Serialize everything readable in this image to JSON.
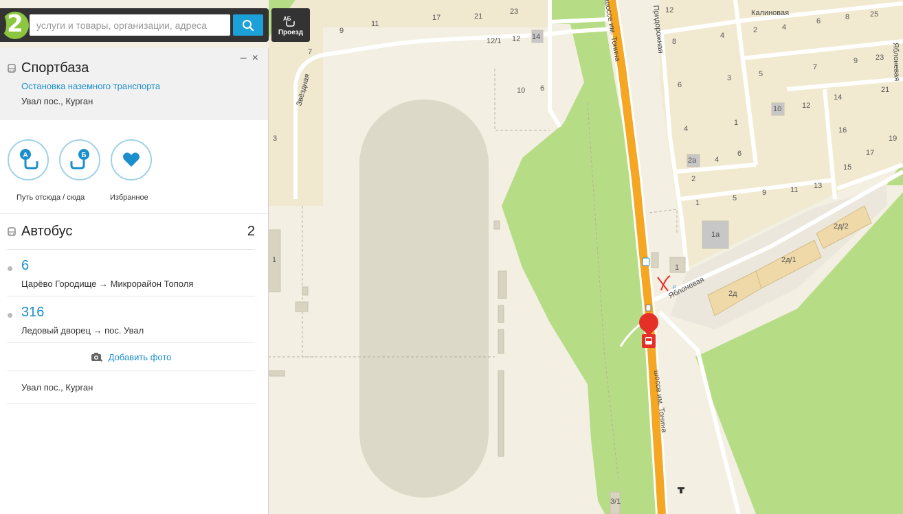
{
  "search": {
    "logo_text": "2",
    "placeholder": "услуги и товары, организации, адреса",
    "route_button_label": "Проезд",
    "route_icon_text": "АБ"
  },
  "panel": {
    "title": "Спортбаза",
    "type_link": "Остановка наземного транспорта",
    "address": "Увал пос., Курган",
    "minimize_symbol": "–",
    "close_symbol": "×",
    "actions": {
      "route_label": "Путь отсюда / сюда",
      "route_a": "А",
      "route_b": "Б",
      "favorites_label": "Избранное"
    },
    "transport": {
      "label": "Автобус",
      "count": "2",
      "routes": [
        {
          "number": "6",
          "direction": "Царёво Городище → Микрорайон Тополя"
        },
        {
          "number": "316",
          "direction": "Ледовый дворец → пос. Увал"
        }
      ]
    },
    "add_photo_label": "Добавить фото",
    "footer_address": "Увал пос., Курган"
  },
  "map": {
    "streets": {
      "zvezdnaya": "Звёздная",
      "kalinovaya": "Калиновая",
      "pridorozhnaya": "Придорожная",
      "yablonevaya": "Яблоневая",
      "shosse_upper": "шоссе им. Тонина",
      "shosse_lower": "шоссе им. Тонина"
    },
    "house_numbers": {
      "h9": "9",
      "h11": "11",
      "h17": "17",
      "h21": "21",
      "h23": "23",
      "h12_1": "12/1",
      "h12": "12",
      "h14": "14",
      "h10": "10",
      "h6": "6",
      "h7": "7",
      "h3": "3",
      "h1_left": "1",
      "r12": "12",
      "r8": "8",
      "r4": "4",
      "r2": "2",
      "r4b": "4",
      "r6": "6",
      "r8b": "8",
      "r25": "25",
      "r23": "23",
      "r9": "9",
      "r7": "7",
      "r5": "5",
      "r3": "3",
      "r6b": "6",
      "r21": "21",
      "r14": "14",
      "r10": "10",
      "r12b": "12",
      "r1": "1",
      "r4c": "4",
      "r16": "16",
      "r17": "17",
      "r19": "19",
      "r15": "15",
      "r2a": "2а",
      "r4d": "4",
      "r6c": "6",
      "r2b": "2",
      "r1b": "1",
      "r5b": "5",
      "r9b": "9",
      "r11": "11",
      "r13": "13",
      "r1a": "1а",
      "r1c": "1",
      "r2d2": "2д/2",
      "r2d1": "2д/1",
      "r2d": "2д",
      "r3_1": "3/1"
    },
    "pin_color": "#e53027",
    "road_color": "#f5a623",
    "green_color": "#b7dc86"
  }
}
